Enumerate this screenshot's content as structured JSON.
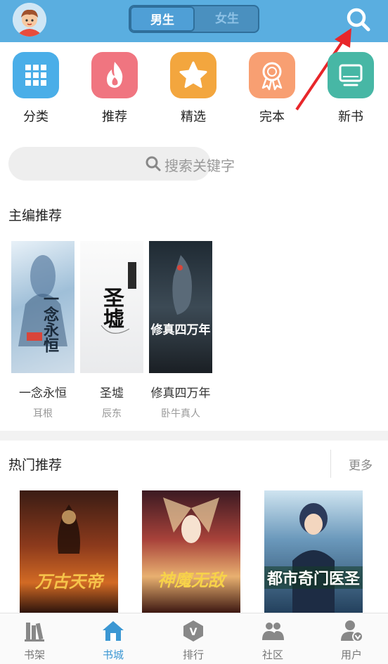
{
  "header": {
    "gender_tabs": [
      {
        "label": "男生",
        "active": true
      },
      {
        "label": "女生",
        "active": false
      }
    ]
  },
  "categories": [
    {
      "label": "分类",
      "icon": "grid-icon",
      "color": "#4aaee8"
    },
    {
      "label": "推荐",
      "icon": "flame-icon",
      "color": "#f07580"
    },
    {
      "label": "精选",
      "icon": "star-icon",
      "color": "#f3a63e"
    },
    {
      "label": "完本",
      "icon": "ribbon-icon",
      "color": "#f89f72"
    },
    {
      "label": "新书",
      "icon": "monitor-icon",
      "color": "#47b7a5"
    }
  ],
  "search": {
    "placeholder": "搜索关键字"
  },
  "editor_picks": {
    "title": "主编推荐",
    "books": [
      {
        "title": "一念永恒",
        "author": "耳根",
        "cover_text": "一念永恒"
      },
      {
        "title": "圣墟",
        "author": "辰东",
        "cover_text": "圣墟"
      },
      {
        "title": "修真四万年",
        "author": "卧牛真人",
        "cover_text": "修真四万年"
      }
    ]
  },
  "hot_picks": {
    "title": "热门推荐",
    "more_label": "更多",
    "books": [
      {
        "cover_text": "万古天帝"
      },
      {
        "cover_text": "神魔无敌"
      },
      {
        "cover_text": "都市奇门医圣"
      }
    ]
  },
  "tabbar": [
    {
      "label": "书架",
      "icon": "bookshelf-icon",
      "active": false
    },
    {
      "label": "书城",
      "icon": "home-icon",
      "active": true
    },
    {
      "label": "排行",
      "icon": "rank-icon",
      "active": false
    },
    {
      "label": "社区",
      "icon": "community-icon",
      "active": false
    },
    {
      "label": "用户",
      "icon": "user-icon",
      "active": false
    }
  ],
  "colors": {
    "header": "#5aaee0",
    "accent": "#3b97d3",
    "annotation_arrow": "#e8262a"
  }
}
